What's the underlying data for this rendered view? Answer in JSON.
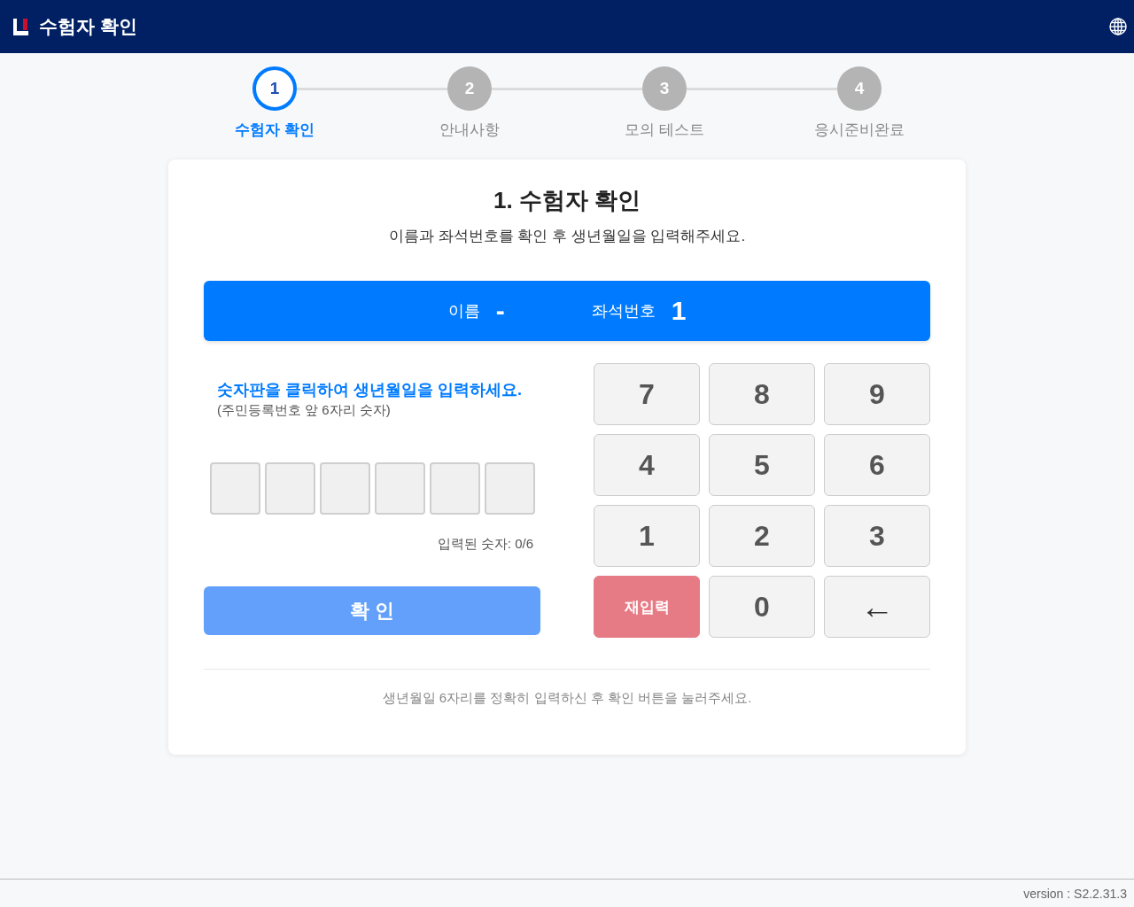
{
  "header": {
    "title": "수험자 확인"
  },
  "steps": [
    {
      "number": "1",
      "label": "수험자 확인",
      "selected": true
    },
    {
      "number": "2",
      "label": "안내사항",
      "selected": false
    },
    {
      "number": "3",
      "label": "모의 테스트",
      "selected": false
    },
    {
      "number": "4",
      "label": "응시준비완료",
      "selected": false
    }
  ],
  "card": {
    "title": "1. 수험자 확인",
    "subtitle": "이름과 좌석번호를 확인 후 생년월일을 입력해주세요.",
    "info_bar": {
      "name_label": "이름",
      "name_value": "-",
      "seat_label": "좌석번호",
      "seat_value": "1"
    },
    "instruction": "숫자판을 클릭하여 생년월일을 입력하세요.",
    "hint": "(주민등록번호 앞 6자리 숫자)",
    "digit_boxes": [
      {
        "filled": false
      },
      {
        "filled": false
      },
      {
        "filled": false
      },
      {
        "filled": false
      },
      {
        "filled": false
      },
      {
        "filled": false
      }
    ],
    "entered_count": "입력된 숫자: 0/6",
    "confirm_button": {
      "label": "확 인",
      "disabled": true
    },
    "keypad": [
      {
        "label": "7",
        "kind": "digit"
      },
      {
        "label": "8",
        "kind": "digit"
      },
      {
        "label": "9",
        "kind": "digit"
      },
      {
        "label": "4",
        "kind": "digit"
      },
      {
        "label": "5",
        "kind": "digit"
      },
      {
        "label": "6",
        "kind": "digit"
      },
      {
        "label": "1",
        "kind": "digit"
      },
      {
        "label": "2",
        "kind": "digit"
      },
      {
        "label": "3",
        "kind": "digit"
      },
      {
        "label": "재입력",
        "kind": "reset"
      },
      {
        "label": "0",
        "kind": "digit"
      },
      {
        "label": "←",
        "kind": "backspace"
      }
    ],
    "note": "생년월일 6자리를 정확히 입력하신 후 확인 버튼을 눌러주세요."
  },
  "footer": {
    "version": "version : S2.2.31.3"
  }
}
